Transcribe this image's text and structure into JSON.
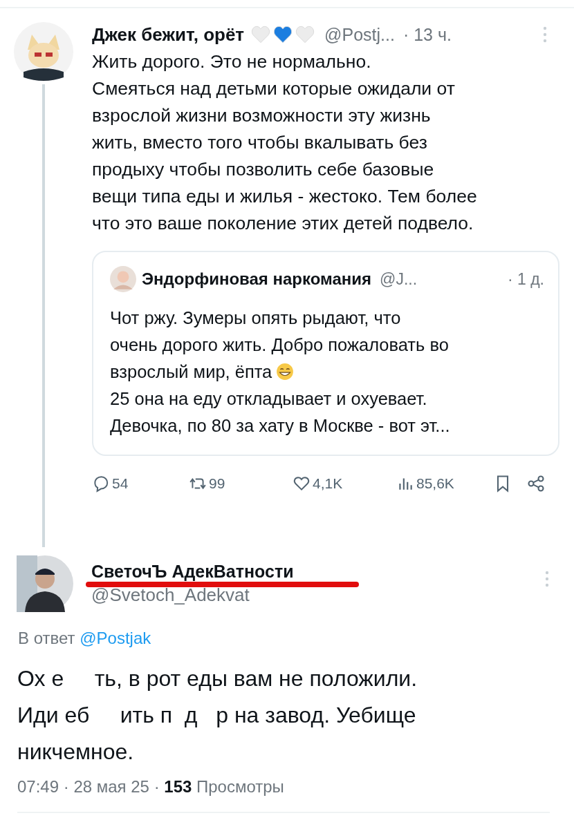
{
  "tweet": {
    "name": "Джек бежит, орёт",
    "hearts": [
      {
        "color": "#ececec"
      },
      {
        "color": "#1c7ee0"
      },
      {
        "color": "#ececec"
      }
    ],
    "handle": "@Postj...",
    "time": "· 13 ч.",
    "lines": [
      "Жить дорого. Это не нормально.",
      "Смеяться над детьми которые ожидали от",
      "взрослой жизни возможности эту жизнь",
      "жить, вместо того чтобы вкалывать без",
      "продыху чтобы позволить себе базовые",
      "вещи типа еды и жилья - жестоко. Тем более",
      "что это ваше поколение этих детей подвело."
    ],
    "quote": {
      "name": "Эндорфиновая наркомания",
      "handle": "@J...",
      "time": "· 1 д.",
      "lines": [
        "Чот ржу. Зумеры опять рыдают, что",
        "очень дорого жить. Добро пожаловать во",
        "взрослый мир, ёпта",
        "25 она на еду откладывает и охуевает.",
        "Девочка, по 80 за хату в Москве - вот эт..."
      ]
    },
    "actions": {
      "replies": "54",
      "reposts": "99",
      "likes": "4,1K",
      "views": "85,6K"
    }
  },
  "reply": {
    "name": "СветочЪ АдекВатности",
    "underlined": true,
    "handle": "@Svetoch_Adekvat",
    "reply_label": "В ответ",
    "reply_to": "@Postjak",
    "lines": [
      "Ох е     ть, в рот еды вам не положили.",
      "Иди еб     ить п  д   р на завод. Уебище",
      "никчемное."
    ],
    "time": "07:49 · 28 мая 25 ·",
    "views_count": "153",
    "views_label": "Просмотры"
  }
}
